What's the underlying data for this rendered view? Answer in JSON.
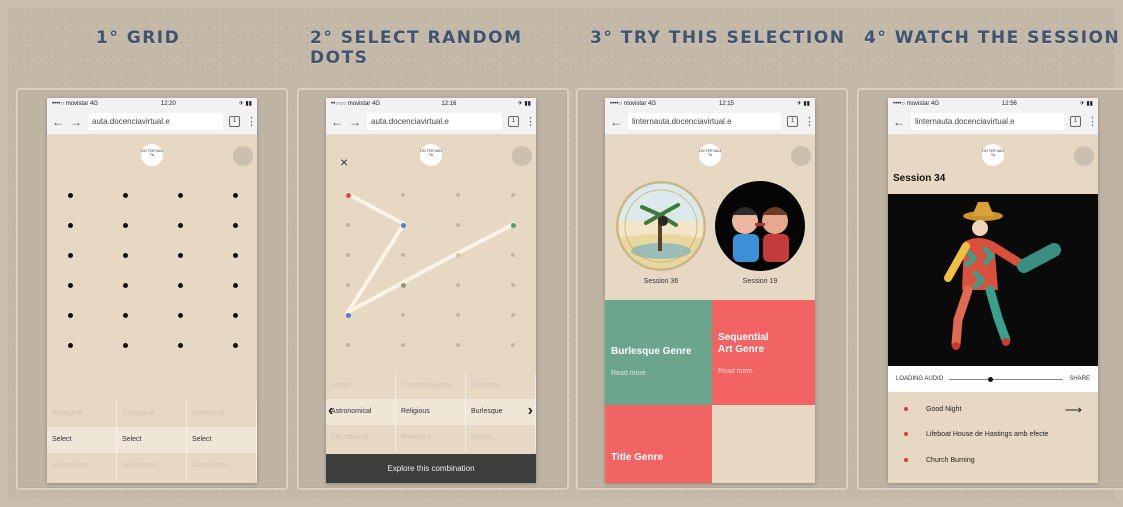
{
  "steps": [
    {
      "title": "1° GRID"
    },
    {
      "title": "2° SELECT RANDOM DOTS"
    },
    {
      "title": "3° TRY THIS SELECTION"
    },
    {
      "title": "4° WATCH THE SESSION"
    }
  ],
  "phones": [
    {
      "status": {
        "carrier": "••••○ movistar 4G",
        "time": "12:20",
        "battery": "✈ ▮▮"
      },
      "url": "auta.docenciavirtual.e",
      "tabs_count": "1",
      "logo_text": "LIN TER NAU TA",
      "categories": [
        [
          "Biological",
          "Zoological",
          "Zoological"
        ],
        [
          "Select",
          "Select",
          "Select"
        ],
        [
          "Adventures",
          "Adventures",
          "Adventures"
        ]
      ]
    },
    {
      "status": {
        "carrier": "••○○○ movistar 4G",
        "time": "12:16",
        "battery": "✈ ▮▮"
      },
      "url": "auta.docenciavirtual.e",
      "tabs_count": "1",
      "logo_text": "LIN TER NAU TA",
      "close": "×",
      "categories": [
        [
          "Artistic",
          "Phantasmagoria",
          "Botanical"
        ],
        [
          "Astronomical",
          "Religious",
          "Burlesque"
        ],
        [
          "Educational",
          "Romance",
          "Ghosts"
        ]
      ],
      "arrow_left": "‹",
      "arrow_right": "›",
      "explore_label": "Explore this combination"
    },
    {
      "status": {
        "carrier": "••••○ movistar 4G",
        "time": "12:15",
        "battery": "✈ ▮▮"
      },
      "url": "linternauta.docenciavirtual.e",
      "tabs_count": "1",
      "logo_text": "LIN TER NAU TA",
      "sessions": [
        {
          "label": "Session 36"
        },
        {
          "label": "Session 19"
        }
      ],
      "genres": [
        {
          "title": "Burlesque Genre",
          "more": "Read more",
          "color": "#6aa58c"
        },
        {
          "title": "Sequential Art Genre",
          "more": "Read more",
          "color": "#f26464"
        },
        {
          "title": "Title Genre",
          "color": "#f26464"
        }
      ]
    },
    {
      "status": {
        "carrier": "••••○ movistar 4G",
        "time": "12:56",
        "battery": "✈ ▮▮"
      },
      "url": "linternauta.docenciavirtual.e",
      "tabs_count": "1",
      "logo_text": "LIN TER NAU TA",
      "session_title": "Session 34",
      "audio": {
        "loading": "LOADING AUDIO",
        "share": "SHARE",
        "progress": 0.34
      },
      "tracks": [
        {
          "title": "Good Night",
          "arrow": "⟶"
        },
        {
          "title": "Lifeboat House de Hastings amb efecte"
        },
        {
          "title": "Church Burning"
        }
      ]
    }
  ]
}
